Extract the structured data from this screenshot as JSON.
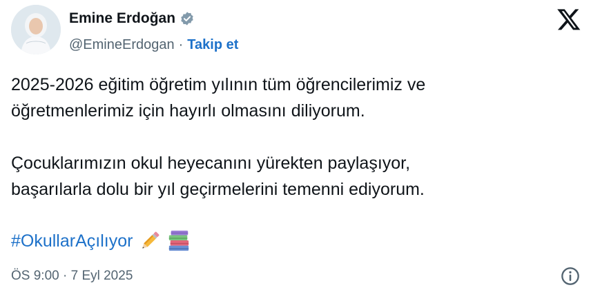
{
  "author": {
    "name": "Emine Erdoğan",
    "handle": "@EmineErdogan",
    "separator": "·",
    "follow_label": "Takip et"
  },
  "tweet": {
    "paragraph_1": "2025-2026 eğitim öğretim yılının tüm öğrencilerimiz ve\nöğretmenlerimiz için hayırlı olmasını diliyorum.",
    "paragraph_2": "Çocuklarımızın okul heyecanını yürekten paylaşıyor,\nbaşarılarla dolu bir yıl geçirmelerini temenni ediyorum.",
    "hashtag": "#OkullarAçılıyor",
    "emojis": [
      "pencil-icon",
      "books-icon"
    ]
  },
  "meta": {
    "timestamp": "ÖS 9:00 · 7 Eyl 2025"
  },
  "colors": {
    "link": "#1d71c9",
    "secondary_text": "#536471",
    "verified_badge": "#829aab"
  }
}
